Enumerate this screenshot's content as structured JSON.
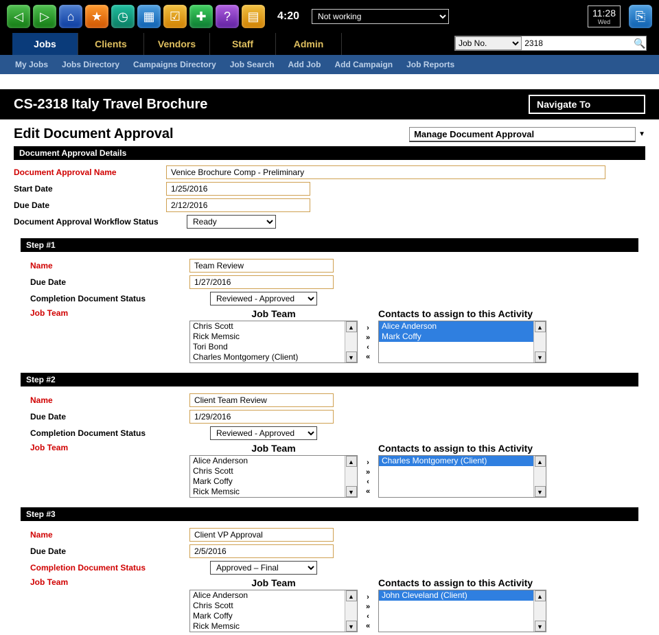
{
  "topbar": {
    "time_left": "4:20",
    "status_select": "Not working",
    "clock_time": "11:28",
    "clock_day": "Wed"
  },
  "icons": {
    "back": "◁",
    "fwd": "▷",
    "home": "⌂",
    "star": "★",
    "clock": "◷",
    "grid": "▦",
    "check": "☑",
    "plus": "✚",
    "help": "?",
    "doc": "▤",
    "exit": "⎘"
  },
  "nav": {
    "tabs": [
      "Jobs",
      "Clients",
      "Vendors",
      "Staff",
      "Admin"
    ],
    "jobno_label": "Job No.",
    "jobno_value": "2318"
  },
  "subnav": [
    "My Jobs",
    "Jobs Directory",
    "Campaigns Directory",
    "Job Search",
    "Add Job",
    "Add Campaign",
    "Job Reports"
  ],
  "page": {
    "title": "CS-2318 Italy Travel Brochure",
    "navigate": "Navigate To",
    "subtitle": "Edit Document Approval",
    "manage_label": "Manage Document Approval"
  },
  "details": {
    "section_label": "Document Approval Details",
    "name_label": "Document Approval Name",
    "name_value": "Venice Brochure Comp - Preliminary",
    "start_label": "Start Date",
    "start_value": "1/25/2016",
    "due_label": "Due Date",
    "due_value": "2/12/2016",
    "status_label": "Document Approval Workflow Status",
    "status_value": "Ready"
  },
  "labels": {
    "name": "Name",
    "due": "Due Date",
    "completion": "Completion Document Status",
    "jobteam": "Job Team",
    "jobteam_head": "Job Team",
    "contacts_head": "Contacts to assign to this Activity"
  },
  "step1": {
    "bar": "Step #1",
    "name": "Team Review",
    "due": "1/27/2016",
    "status": "Reviewed - Approved",
    "team": [
      "Chris Scott",
      "Rick Memsic",
      "Tori Bond",
      "Charles Montgomery (Client)"
    ],
    "contacts": [
      "Alice Anderson",
      "Mark Coffy"
    ]
  },
  "step2": {
    "bar": "Step #2",
    "name": "Client Team Review",
    "due": "1/29/2016",
    "status": "Reviewed - Approved",
    "team": [
      "Alice Anderson",
      "Chris Scott",
      "Mark Coffy",
      "Rick Memsic"
    ],
    "contacts": [
      "Charles Montgomery (Client)"
    ]
  },
  "step3": {
    "bar": "Step #3",
    "name": "Client VP Approval",
    "due": "2/5/2016",
    "status": "Approved – Final",
    "team": [
      "Alice Anderson",
      "Chris Scott",
      "Mark Coffy",
      "Rick Memsic"
    ],
    "contacts": [
      "John Cleveland (Client)"
    ]
  }
}
